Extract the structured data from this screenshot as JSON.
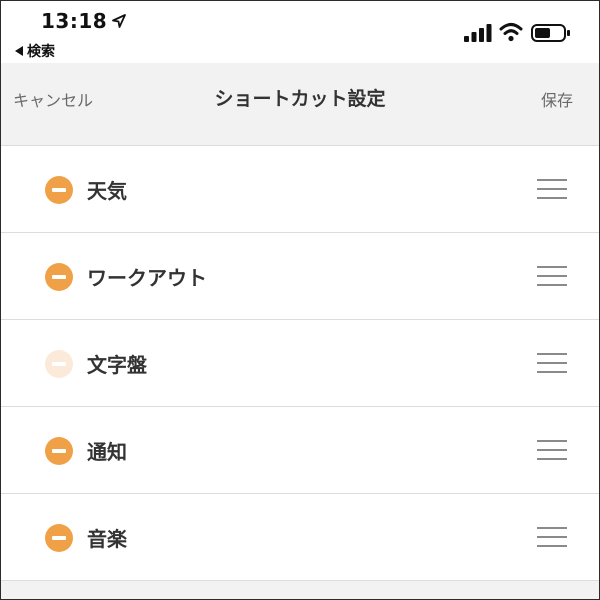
{
  "status_bar": {
    "time": "13:18",
    "back_label": "検索"
  },
  "nav": {
    "cancel_label": "キャンセル",
    "title": "ショートカット設定",
    "save_label": "保存"
  },
  "list": {
    "items": [
      {
        "label": "天気",
        "dimmed": false
      },
      {
        "label": "ワークアウト",
        "dimmed": false
      },
      {
        "label": "文字盤",
        "dimmed": true
      },
      {
        "label": "通知",
        "dimmed": false
      },
      {
        "label": "音楽",
        "dimmed": false
      }
    ]
  },
  "colors": {
    "accent": "#f0a147",
    "accent_dim": "#fbeada",
    "nav_background": "#f2f2f2"
  },
  "icons": {
    "remove": "minus-circle-icon",
    "drag": "drag-handle-icon"
  }
}
